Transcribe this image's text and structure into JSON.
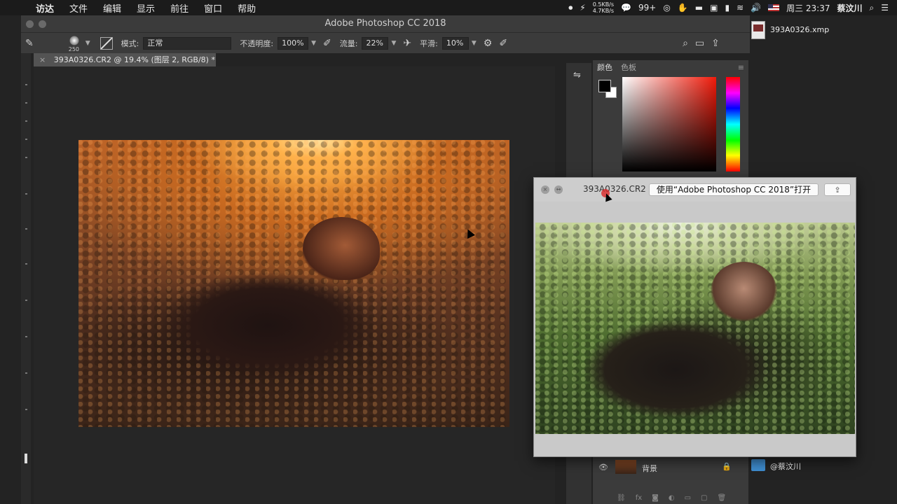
{
  "menubar": {
    "app_menu": [
      "访达",
      "文件",
      "编辑",
      "显示",
      "前往",
      "窗口",
      "帮助"
    ],
    "net_up": "0.5KB/s",
    "net_down": "4.7KB/s",
    "wechat_count": "99+",
    "clock": "周三 23:37",
    "user": "蔡汶川"
  },
  "photoshop": {
    "window_title": "Adobe Photoshop CC 2018",
    "options": {
      "brush_size": "250",
      "mode_label": "模式:",
      "mode_value": "正常",
      "opacity_label": "不透明度:",
      "opacity_value": "100%",
      "flow_label": "流量:",
      "flow_value": "22%",
      "smooth_label": "平滑:",
      "smooth_value": "10%"
    },
    "doc_tab": "393A0326.CR2 @ 19.4% (图层 2, RGB/8) *",
    "color_panel": {
      "tab_color": "颜色",
      "tab_swatches": "色板"
    },
    "layers": {
      "layer_name": "背景"
    }
  },
  "quicklook": {
    "filename": "393A0326.CR2",
    "open_button": "使用“Adobe Photoshop CC 2018”打开"
  },
  "desktop": {
    "file_label": "393A0326.xmp",
    "folder_label": "@蔡汶川"
  }
}
